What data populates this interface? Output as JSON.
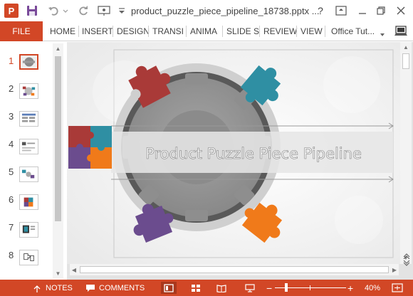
{
  "window": {
    "app_logo": "P",
    "title": "product_puzzle_piece_pipeline_18738.pptx ...",
    "help": "?",
    "icons": [
      "powerpoint-icon",
      "save-icon",
      "undo-icon",
      "redo-icon",
      "present-from-beginning-icon",
      "customize-qat-icon",
      "ribbon-display-options-icon",
      "minimize-icon",
      "restore-icon",
      "close-icon"
    ]
  },
  "ribbon": {
    "file": "FILE",
    "tabs": [
      "HOME",
      "INSERT",
      "DESIGN",
      "TRANSI",
      "ANIMA",
      "SLIDE S",
      "REVIEW",
      "VIEW"
    ],
    "account": "Office Tut..."
  },
  "thumbnails": {
    "numbers": [
      "1",
      "2",
      "3",
      "4",
      "5",
      "6",
      "7",
      "8"
    ],
    "selected": "1"
  },
  "slide": {
    "title": "Product Puzzle Piece Pipeline",
    "piece_colors": {
      "red": "#a93a38",
      "teal": "#2f8fa3",
      "purple": "#6b4c8e",
      "orange": "#f07a1a"
    }
  },
  "statusbar": {
    "notes": "NOTES",
    "comments": "COMMENTS",
    "zoom": "40%",
    "zoom_out": "−",
    "zoom_in": "+"
  },
  "colors": {
    "accent": "#d24726",
    "status_bar": "#d24726"
  }
}
